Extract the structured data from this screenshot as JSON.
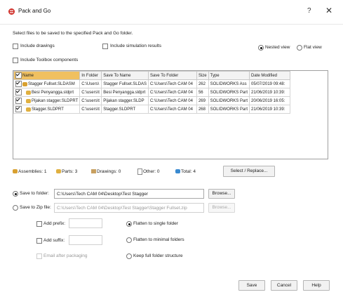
{
  "window": {
    "title": "Pack and Go",
    "help_label": "?",
    "close_label": "✕"
  },
  "instructions": "Select files to be saved to the specified Pack and Go folder.",
  "options": {
    "include_drawings": "Include drawings",
    "include_simulation": "Include simulation results",
    "include_toolbox": "Include Toolbox components",
    "nested_view": "Nested view",
    "flat_view": "Flat view"
  },
  "table": {
    "headers": [
      "Name",
      "In Folder",
      "Save To Name",
      "Save To Folder",
      "Size",
      "Type",
      "Date Modified"
    ],
    "rows": [
      {
        "name": "Stagger Fullset.SLDASM",
        "in_folder": "C:\\Users\\",
        "save_name": "Stagger Fullset.SLDAS",
        "save_folder": "C:\\Users\\Tech CAM 04",
        "size": "262",
        "type": "SOLIDWORKS Ass",
        "date": "05/07/2019 09:48:"
      },
      {
        "name": "Besi Penyangga.sldprt",
        "in_folder": "C:\\users\\t",
        "save_name": "Besi Penyangga.sldprt",
        "save_folder": "C:\\Users\\Tech CAM 04",
        "size": "56",
        "type": "SOLIDWORKS Part",
        "date": "21/06/2019 10:39:"
      },
      {
        "name": "Pijakan stagger.SLDPRT",
        "in_folder": "C:\\users\\t",
        "save_name": "Pijakan stagger.SLDP",
        "save_folder": "C:\\Users\\Tech CAM 04",
        "size": "269",
        "type": "SOLIDWORKS Part",
        "date": "20/06/2019 16:05:"
      },
      {
        "name": "Stagger.SLDPRT",
        "in_folder": "C:\\users\\t",
        "save_name": "Stagger.SLDPRT",
        "save_folder": "C:\\Users\\Tech CAM 04",
        "size": "268",
        "type": "SOLIDWORKS Part",
        "date": "21/06/2019 10:39:"
      }
    ]
  },
  "summary": {
    "assemblies": "Assemblies: 1",
    "parts": "Parts: 3",
    "drawings": "Drawings: 0",
    "other": "Other: 0",
    "total": "Total: 4",
    "select_replace": "Select / Replace..."
  },
  "save": {
    "to_folder_label": "Save to folder:",
    "folder_path": "C:\\Users\\Tech CAM 04\\Desktop\\Test Stagger",
    "browse": "Browse...",
    "to_zip_label": "Save to Zip file:",
    "zip_path": "C:\\Users\\Tech CAM 04\\Desktop\\Test Stagger\\Stagger Fullset.zip",
    "add_prefix": "Add prefix:",
    "add_suffix": "Add suffix:",
    "email_after": "Email after packaging",
    "flatten_single": "Flatten to single folder",
    "flatten_minimal": "Flatten to minimal folders",
    "keep_full": "Keep full folder structure"
  },
  "buttons": {
    "save": "Save",
    "cancel": "Cancel",
    "help": "Help"
  },
  "colors": {
    "name_header": "#f0c060",
    "assembly_icon": "#d8a030",
    "part_icon": "#e0b040"
  }
}
